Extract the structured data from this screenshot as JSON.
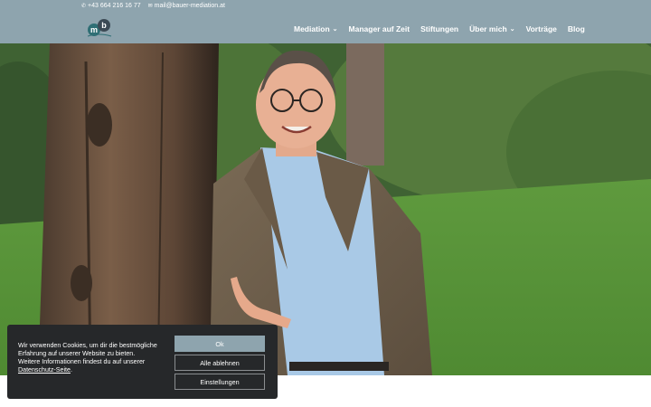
{
  "header": {
    "phone": "+43 664 216 16 77",
    "email": "mail@bauer-mediation.at",
    "logo_alt": "mb"
  },
  "nav": {
    "items": [
      {
        "label": "Mediation",
        "has_dropdown": true
      },
      {
        "label": "Manager auf Zeit",
        "has_dropdown": false
      },
      {
        "label": "Stiftungen",
        "has_dropdown": false
      },
      {
        "label": "Über mich",
        "has_dropdown": true
      },
      {
        "label": "Vorträge",
        "has_dropdown": false
      },
      {
        "label": "Blog",
        "has_dropdown": false
      }
    ]
  },
  "cookie": {
    "line1": "Wir verwenden Cookies, um dir die bestmögliche Erfahrung auf unserer Website zu bieten.",
    "line2": "Weitere Informationen findest du auf unserer",
    "link": "Datenschutz-Seite",
    "link_suffix": ".",
    "ok_label": "Ok",
    "deny_label": "Alle ablehnen",
    "settings_label": "Einstellungen"
  },
  "colors": {
    "header_bg": "#8ea4ae",
    "banner_bg": "#26282a",
    "accent": "#8ea4ae"
  },
  "icons": {
    "phone": "phone-icon",
    "email": "mail-icon",
    "dropdown": "chevron-down-icon"
  }
}
